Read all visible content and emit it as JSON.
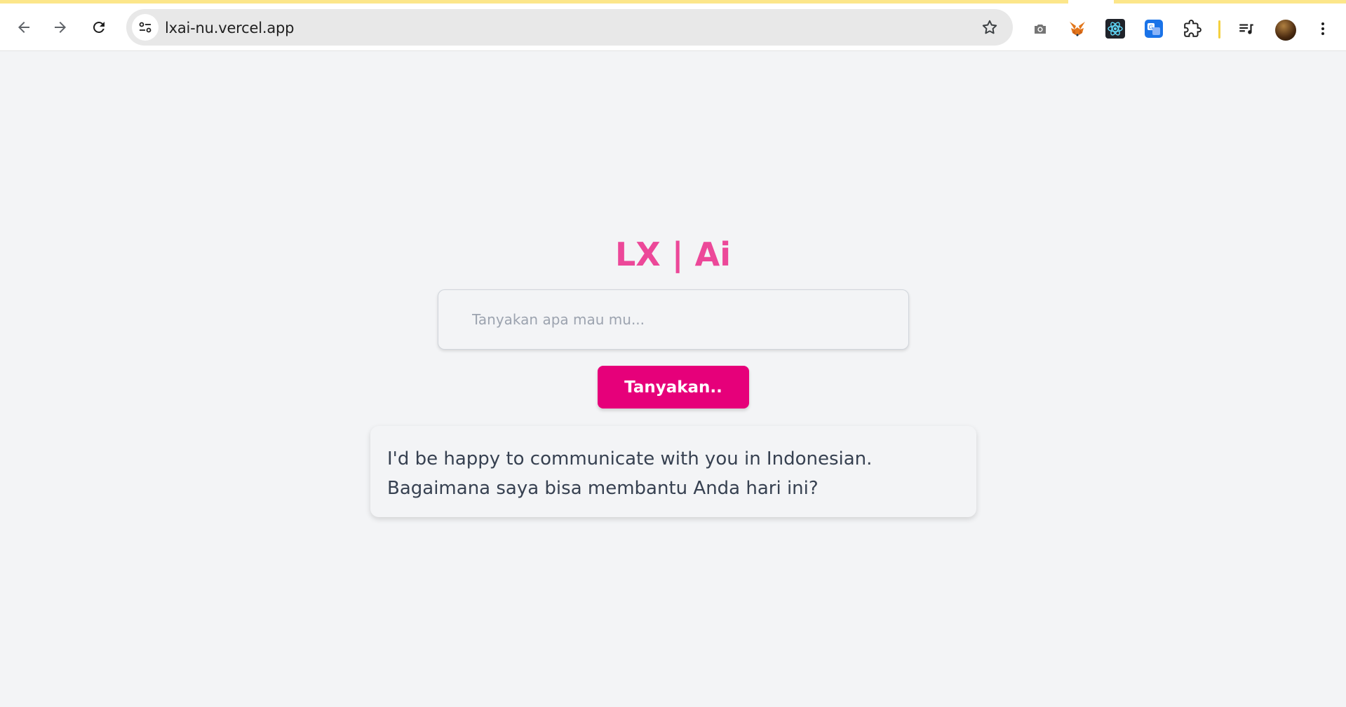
{
  "browser": {
    "url": "lxai-nu.vercel.app",
    "icons": {
      "back": "arrow-left-icon",
      "forward": "arrow-right-icon",
      "reload": "reload-icon",
      "site_info": "tune-icon",
      "bookmark": "star-icon",
      "camera": "camera-icon",
      "metamask": "fox-icon",
      "react_devtools": "atom-icon",
      "translate": "translate-icon",
      "extensions": "puzzle-icon",
      "media": "playlist-icon",
      "profile": "avatar",
      "menu": "kebab-menu-icon"
    }
  },
  "app": {
    "title": "LX | Ai",
    "input_placeholder": "Tanyakan apa mau mu...",
    "input_value": "",
    "button_label": "Tanyakan..",
    "response": "I'd be happy to communicate with you in Indonesian. Bagaimana saya bisa membantu Anda hari ini?"
  },
  "colors": {
    "accent": "#ec4899",
    "button": "#e6007a",
    "background": "#f3f4f6",
    "text": "#374151"
  }
}
